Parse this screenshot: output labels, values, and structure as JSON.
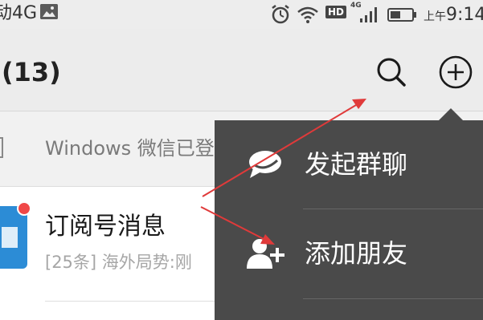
{
  "status_bar": {
    "carrier": "动4G",
    "time_prefix": "上午",
    "time": "9:14",
    "network": "4G",
    "hd_badge": "HD"
  },
  "header": {
    "title": "(13)",
    "search_icon": "search-icon",
    "add_icon": "plus-circle-icon"
  },
  "banner": {
    "text": "Windows 微信已登"
  },
  "conversation": {
    "title": "订阅号消息",
    "preview": "[25条] 海外局势:刚",
    "avatar_color": "#2c8cd6",
    "badge_color": "#f04848"
  },
  "popup_menu": {
    "items": [
      {
        "label": "发起群聊",
        "icon": "chat-bubble-icon"
      },
      {
        "label": "添加朋友",
        "icon": "add-friend-icon"
      }
    ]
  },
  "colors": {
    "accent_red": "#e03a3a",
    "menu_bg": "#4a4a4a",
    "header_bg": "#ececec"
  }
}
